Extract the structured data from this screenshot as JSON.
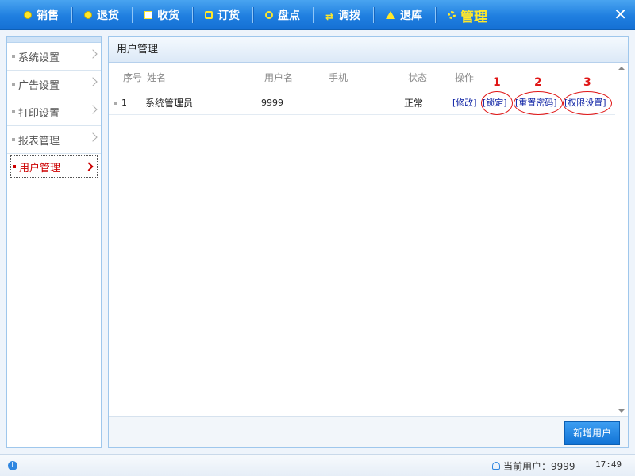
{
  "topnav": {
    "items": [
      {
        "label": "销售",
        "icon": "plus-circle-icon"
      },
      {
        "label": "退货",
        "icon": "minus-circle-icon"
      },
      {
        "label": "收货",
        "icon": "document-icon"
      },
      {
        "label": "订货",
        "icon": "message-icon"
      },
      {
        "label": "盘点",
        "icon": "key-icon"
      },
      {
        "label": "调拨",
        "icon": "transfer-arrows-icon"
      },
      {
        "label": "退库",
        "icon": "house-icon"
      },
      {
        "label": "管理",
        "icon": "gear-icon"
      }
    ],
    "close_label": "✕"
  },
  "sidebar": {
    "items": [
      {
        "label": "系统设置"
      },
      {
        "label": "广告设置"
      },
      {
        "label": "打印设置"
      },
      {
        "label": "报表管理"
      },
      {
        "label": "用户管理"
      }
    ]
  },
  "panel": {
    "title": "用户管理",
    "columns": [
      "序号",
      "姓名",
      "用户名",
      "手机",
      "状态",
      "操作"
    ],
    "rows": [
      {
        "index": "1",
        "name": "系统管理员",
        "username": "9999",
        "phone": "",
        "status": "正常",
        "actions": [
          "[修改]",
          "[锁定]",
          "[重置密码]",
          "[权限设置]"
        ]
      }
    ],
    "add_button": "新增用户"
  },
  "annotations": [
    "1",
    "2",
    "3"
  ],
  "statusbar": {
    "current_user": "当前用户：9999",
    "time": "17:49"
  },
  "colors": {
    "topbar": "#1f7fe0",
    "active_nav": "#ffe82a",
    "active_side": "#cc0000",
    "link": "#0a1fa3",
    "annotation": "#e01616"
  }
}
